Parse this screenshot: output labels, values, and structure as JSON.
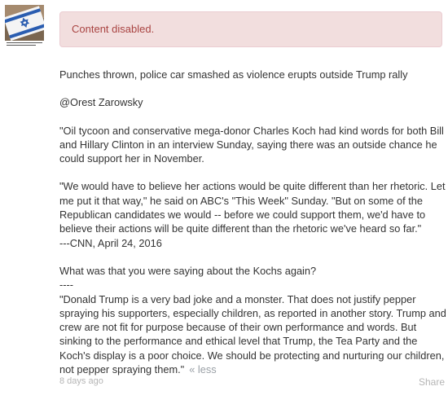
{
  "alert": {
    "text": "Content disabled."
  },
  "post": {
    "paragraphs": [
      "Punches thrown, police car smashed as violence erupts outside Trump rally",
      "@Orest Zarowsky",
      "\"Oil tycoon and conservative mega-donor Charles Koch had kind words for both Bill and Hillary Clinton in an interview Sunday, saying there was an outside chance he could support her in November.",
      "\"We would have to believe her actions would be quite different than her rhetoric. Let me put it that way,\" he said on ABC's \"This Week\" Sunday. \"But on some of the Republican candidates we would -- before we could support them, we'd have to believe their actions will be quite different than the rhetoric we've heard so far.\"",
      "---CNN, April 24, 2016",
      "What was that you were saying about the Kochs again?",
      "----",
      "\"Donald Trump is a very bad joke and a monster. That does not justify pepper spraying his supporters, especially children, as reported in another story. Trump and crew are not fit for purpose because of their own performance and words. But sinking to the performance and ethical level that Trump, the Tea Party and the Koch's display is a poor choice. We should be protecting and nurturing our children, not pepper spraying them.\""
    ],
    "less_link": "« less"
  },
  "footer": {
    "timestamp": "8 days ago",
    "share_label": "Share"
  },
  "colors": {
    "alert_bg": "#f2dede",
    "alert_text": "#a94442",
    "muted": "#b5b5b5"
  },
  "avatar": {
    "icon": "israel-flag-avatar-icon"
  }
}
